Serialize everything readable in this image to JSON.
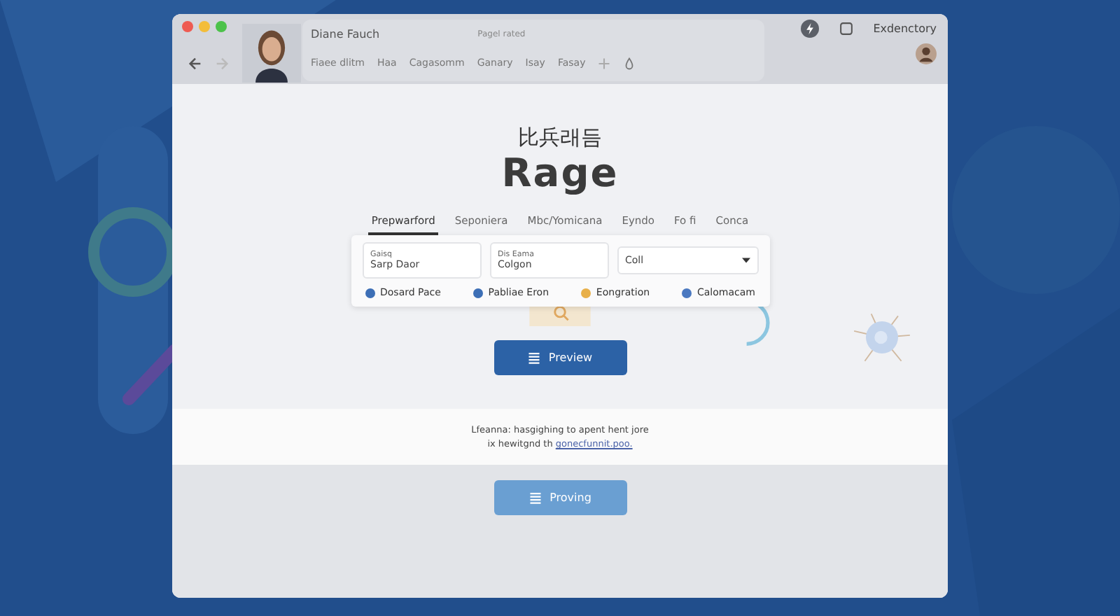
{
  "browser": {
    "tab_title": "Diane Fauch",
    "page_title": "Pagel rated",
    "profile_label": "Exdenctory",
    "toolbar_items": [
      "Fiaee dlitm",
      "Haa",
      "Cagasomm",
      "Ganary",
      "Isay",
      "Fasay"
    ]
  },
  "hero": {
    "subtitle": "比兵래듬",
    "title": "Rage"
  },
  "tabs": [
    {
      "label": "Prepwarford",
      "selected": true
    },
    {
      "label": "Seponiera",
      "selected": false
    },
    {
      "label": "Mbc/Yomicana",
      "selected": false
    },
    {
      "label": "Eyndo",
      "selected": false
    },
    {
      "label": "Fo fi",
      "selected": false
    },
    {
      "label": "Conca",
      "selected": false
    }
  ],
  "form": {
    "fields": [
      {
        "label": "Gaisq",
        "value": "Sarp Daor"
      },
      {
        "label": "Dis Eama",
        "value": "Colgon"
      }
    ],
    "select": {
      "value": "Coll"
    },
    "options": [
      {
        "label": "Dosard Pace",
        "color": "#3d6fb6"
      },
      {
        "label": "Pabliae Eron",
        "color": "#3d6fb6"
      },
      {
        "label": "Eongration",
        "color": "#e8b04a"
      },
      {
        "label": "Calomacam",
        "color": "#4a78c0"
      }
    ]
  },
  "primary_button": "Preview",
  "note": {
    "text": "Lfeanna: hasgighing to apent hent jore ix hewitgnd th",
    "link": "gonecfunnit.poo."
  },
  "secondary_button": "Proving"
}
